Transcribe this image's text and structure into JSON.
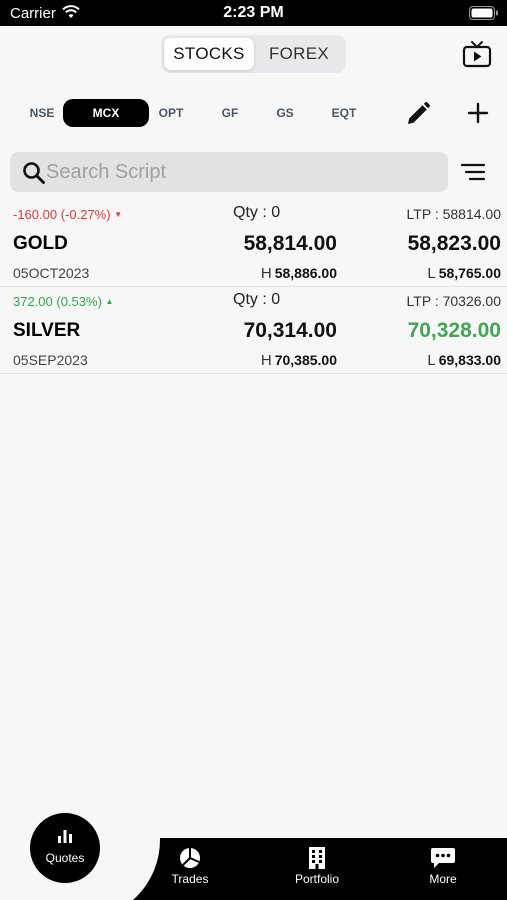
{
  "status_bar": {
    "carrier": "Carrier",
    "time": "2:23 PM"
  },
  "segment": {
    "options": [
      "STOCKS",
      "FOREX"
    ],
    "selected": "STOCKS"
  },
  "exchange_tabs": [
    {
      "label": "NSE",
      "active": false
    },
    {
      "label": "MCX",
      "active": true
    },
    {
      "label": "OPT",
      "active": false
    },
    {
      "label": "GF",
      "active": false
    },
    {
      "label": "GS",
      "active": false
    },
    {
      "label": "EQT",
      "active": false
    }
  ],
  "search": {
    "placeholder": "Search Script",
    "value": ""
  },
  "quotes": [
    {
      "change": "-160.00 (-0.27%)",
      "direction": "down",
      "qty": "Qty : 0",
      "ltp": "LTP : 58814.00",
      "name": "GOLD",
      "bid": "58,814.00",
      "ask": "58,823.00",
      "expiry": "05OCT2023",
      "high_label": "H",
      "high": "58,886.00",
      "low_label": "L",
      "low": "58,765.00"
    },
    {
      "change": "372.00 (0.53%)",
      "direction": "up",
      "qty": "Qty : 0",
      "ltp": "LTP : 70326.00",
      "name": "SILVER",
      "bid": "70,314.00",
      "ask": "70,328.00",
      "expiry": "05SEP2023",
      "high_label": "H",
      "high": "70,385.00",
      "low_label": "L",
      "low": "69,833.00"
    }
  ],
  "bottom_nav": {
    "quotes": "Quotes",
    "trades": "Trades",
    "portfolio": "Portfolio",
    "more": "More"
  },
  "colors": {
    "down": "#e53935",
    "up": "#2fa84f",
    "ask_up": "#43a556",
    "nav_bg": "#000000"
  }
}
